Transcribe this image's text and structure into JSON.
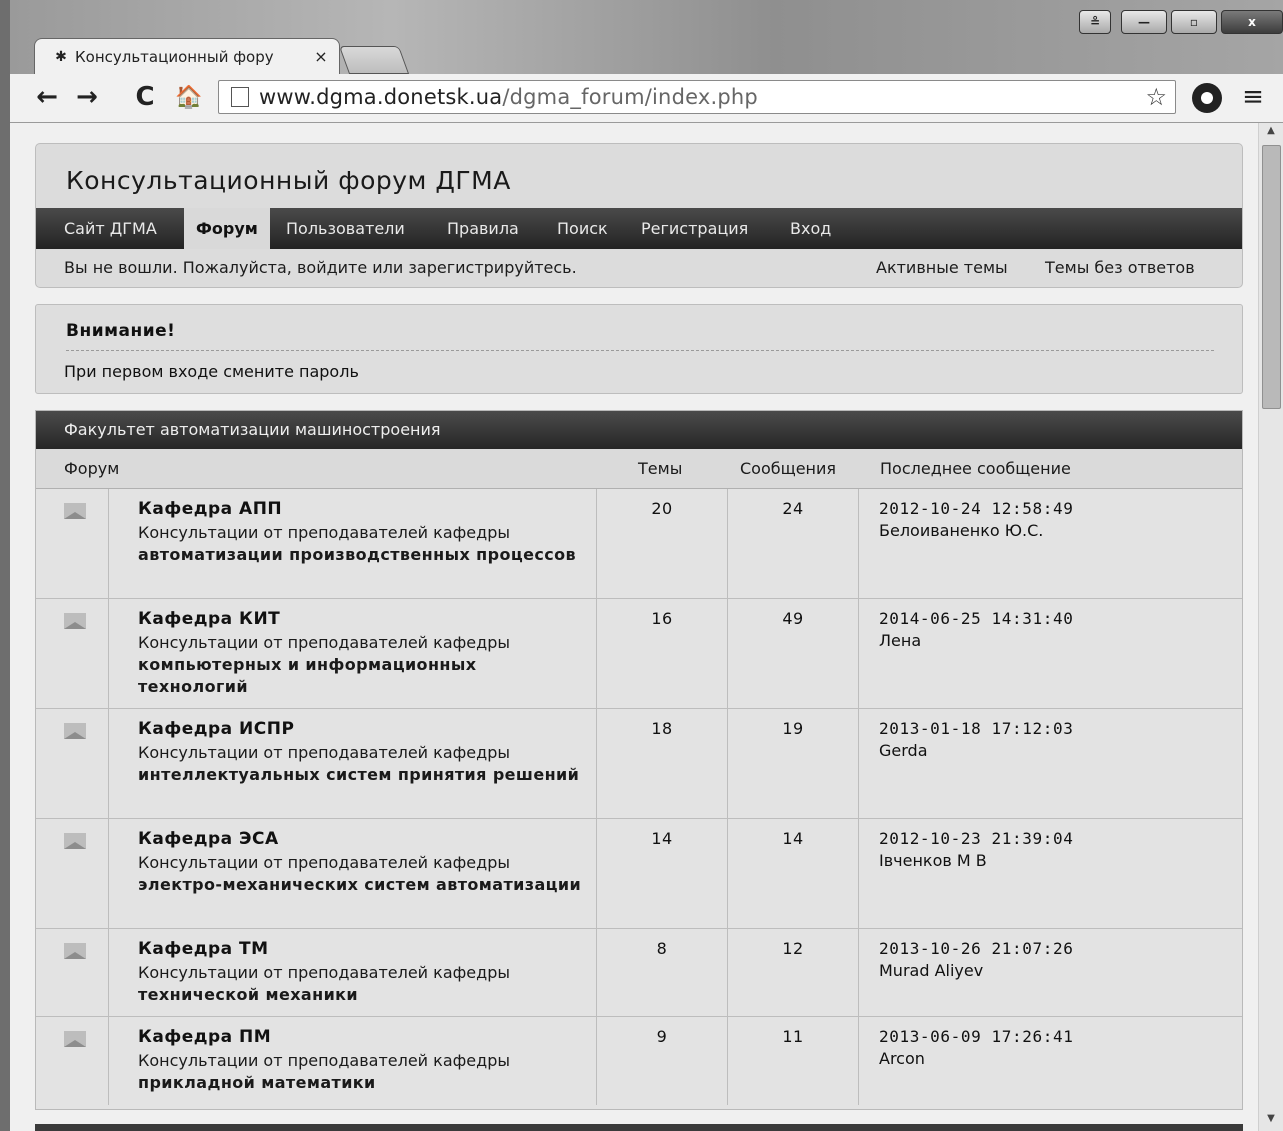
{
  "browser": {
    "tab_title": "Консультационный фору",
    "tab_close": "×",
    "url_host": "www.dgma.donetsk.ua",
    "url_path": "/dgma_forum/index.php",
    "back": "←",
    "forward": "→",
    "reload": "C",
    "home": "🏠",
    "star": "☆",
    "menu": "≡",
    "win_user": "≗",
    "win_min": "—",
    "win_max": "▫",
    "win_close": "x"
  },
  "header": {
    "title": "Консультационный форум ДГМА",
    "nav": [
      {
        "label": "Сайт ДГМА"
      },
      {
        "label": "Форум"
      },
      {
        "label": "Пользователи"
      },
      {
        "label": "Правила"
      },
      {
        "label": "Поиск"
      },
      {
        "label": "Регистрация"
      },
      {
        "label": "Вход"
      }
    ],
    "status": "Вы не вошли. Пожалуйста, войдите или зарегистрируйтесь.",
    "active_topics": "Активные темы",
    "unanswered": "Темы без ответов"
  },
  "notice": {
    "title": "Внимание!",
    "text": "При первом входе смените пароль"
  },
  "category": {
    "title": "Факультет автоматизации машиностроения",
    "columns": {
      "forum": "Форум",
      "topics": "Темы",
      "posts": "Сообщения",
      "last": "Последнее сообщение"
    },
    "rows": [
      {
        "name": "Кафедра АПП",
        "desc_prefix": "Консультации от преподавателей кафедры",
        "desc_bold": "автоматизации производственных процессов",
        "topics": "20",
        "posts": "24",
        "last_date": "2012-10-24 12:58:49",
        "last_author": "Белоиваненко Ю.С."
      },
      {
        "name": "Кафедра КИТ",
        "desc_prefix": "Консультации от преподавателей кафедры",
        "desc_bold": "компьютерных и информационных технологий",
        "topics": "16",
        "posts": "49",
        "last_date": "2014-06-25 14:31:40",
        "last_author": "Лена"
      },
      {
        "name": "Кафедра ИСПР",
        "desc_prefix": "Консультации от преподавателей кафедры",
        "desc_bold": "интеллектуальных систем принятия решений",
        "topics": "18",
        "posts": "19",
        "last_date": "2013-01-18 17:12:03",
        "last_author": "Gerda"
      },
      {
        "name": "Кафедра ЭСА",
        "desc_prefix": "Консультации от преподавателей кафедры",
        "desc_bold": "электро-механических систем автоматизации",
        "topics": "14",
        "posts": "14",
        "last_date": "2012-10-23 21:39:04",
        "last_author": "Івченков М В"
      },
      {
        "name": "Кафедра ТМ",
        "desc_prefix": "Консультации от преподавателей кафедры",
        "desc_bold": "технической механики",
        "topics": "8",
        "posts": "12",
        "last_date": "2013-10-26 21:07:26",
        "last_author": "Murad Aliyev"
      },
      {
        "name": "Кафедра ПМ",
        "desc_prefix": "Консультации от преподавателей кафедры",
        "desc_bold": "прикладной математики",
        "topics": "9",
        "posts": "11",
        "last_date": "2013-06-09 17:26:41",
        "last_author": "Arcon"
      }
    ]
  }
}
